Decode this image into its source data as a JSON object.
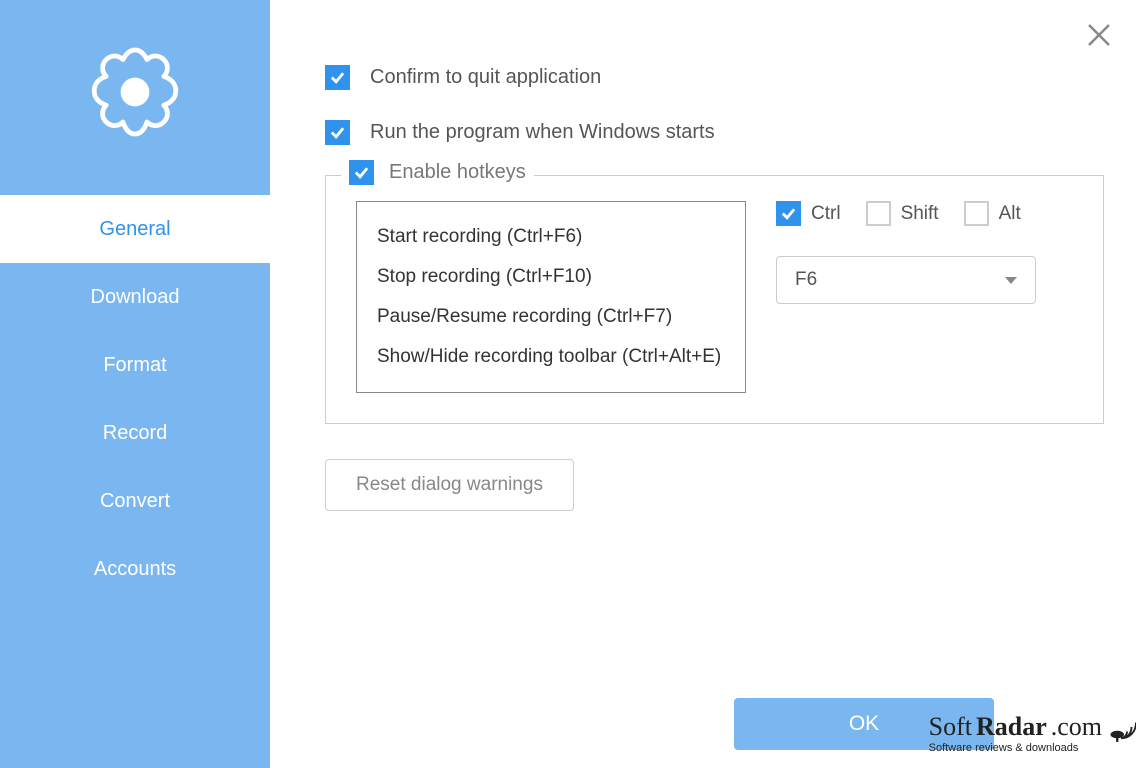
{
  "sidebar": {
    "items": [
      {
        "label": "General",
        "active": true
      },
      {
        "label": "Download",
        "active": false
      },
      {
        "label": "Format",
        "active": false
      },
      {
        "label": "Record",
        "active": false
      },
      {
        "label": "Convert",
        "active": false
      },
      {
        "label": "Accounts",
        "active": false
      }
    ]
  },
  "settings": {
    "confirm_quit_label": "Confirm to quit application",
    "run_on_startup_label": "Run the program when Windows starts",
    "enable_hotkeys_label": "Enable hotkeys",
    "hotkeys": [
      "Start recording (Ctrl+F6)",
      "Stop recording (Ctrl+F10)",
      "Pause/Resume recording (Ctrl+F7)",
      "Show/Hide recording toolbar (Ctrl+Alt+E)"
    ],
    "modifiers": {
      "ctrl_label": "Ctrl",
      "shift_label": "Shift",
      "alt_label": "Alt",
      "ctrl_checked": true,
      "shift_checked": false,
      "alt_checked": false
    },
    "key_value": "F6",
    "reset_label": "Reset dialog warnings",
    "ok_label": "OK"
  },
  "watermark": {
    "brand_prefix": "Soft",
    "brand_mid": "Radar",
    "brand_suffix": ".com",
    "tagline": "Software reviews & downloads"
  }
}
